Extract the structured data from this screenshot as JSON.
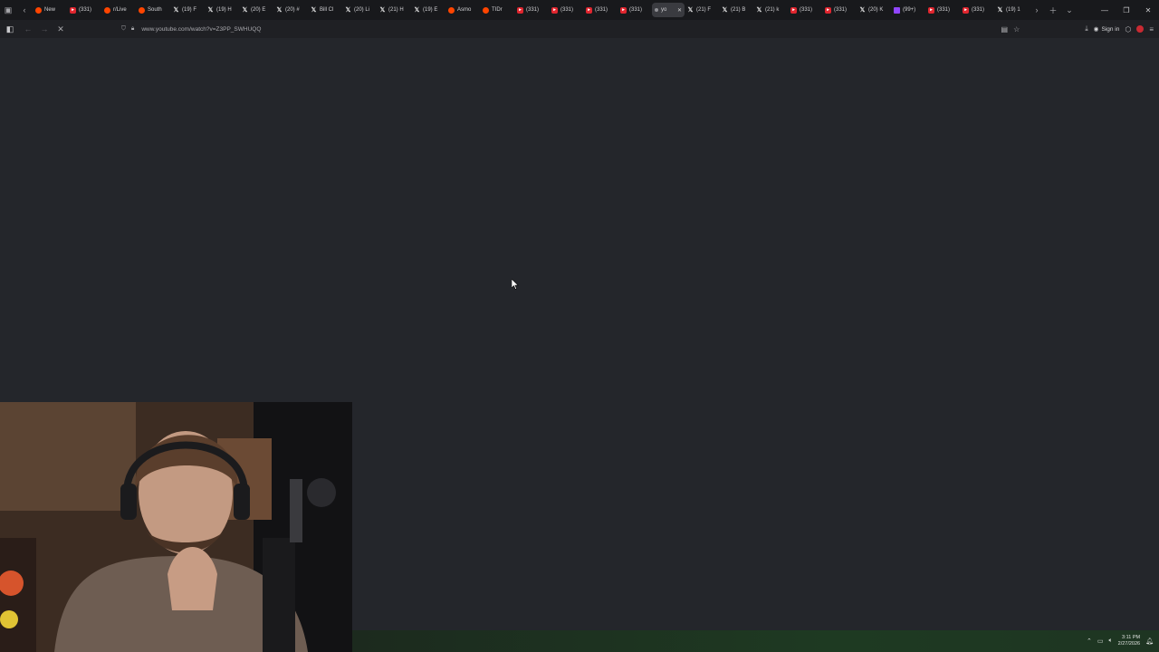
{
  "browser": {
    "tabs": [
      {
        "favicon": "reddit-icon",
        "title": "New"
      },
      {
        "favicon": "youtube-icon",
        "title": "(331)"
      },
      {
        "favicon": "reddit-icon",
        "title": "r/Live"
      },
      {
        "favicon": "reddit-icon",
        "title": "South"
      },
      {
        "favicon": "x-icon",
        "title": "(19) F"
      },
      {
        "favicon": "x-icon",
        "title": "(19) H"
      },
      {
        "favicon": "x-icon",
        "title": "(20) E"
      },
      {
        "favicon": "x-icon",
        "title": "(20) #"
      },
      {
        "favicon": "x-icon",
        "title": "Bill Cl"
      },
      {
        "favicon": "x-icon",
        "title": "(20) Li"
      },
      {
        "favicon": "x-icon",
        "title": "(21) H"
      },
      {
        "favicon": "x-icon",
        "title": "(19) E"
      },
      {
        "favicon": "reddit-icon",
        "title": "Asmo"
      },
      {
        "favicon": "reddit-icon",
        "title": "TIDr"
      },
      {
        "favicon": "youtube-icon",
        "title": "(331)"
      },
      {
        "favicon": "youtube-icon",
        "title": "(331)"
      },
      {
        "favicon": "youtube-icon",
        "title": "(331)"
      },
      {
        "favicon": "youtube-icon",
        "title": "(331)"
      },
      {
        "favicon": "loading-dot-icon",
        "title": "yo",
        "active": true
      },
      {
        "favicon": "x-icon",
        "title": "(21) F"
      },
      {
        "favicon": "x-icon",
        "title": "(21) B"
      },
      {
        "favicon": "x-icon",
        "title": "(21) k"
      },
      {
        "favicon": "youtube-icon",
        "title": "(331)"
      },
      {
        "favicon": "youtube-icon",
        "title": "(331)"
      },
      {
        "favicon": "x-icon",
        "title": "(20) K"
      },
      {
        "favicon": "twitch-icon",
        "title": "(99+)"
      },
      {
        "favicon": "youtube-icon",
        "title": "(331)"
      },
      {
        "favicon": "youtube-icon",
        "title": "(331)"
      },
      {
        "favicon": "x-icon",
        "title": "(19) 1"
      }
    ],
    "url": "www.youtube.com/watch?v=Z3PP_SWHUQQ",
    "sign_in_label": "Sign in",
    "colors": {
      "youtube": "#e0262f",
      "reddit": "#ff4500",
      "twitch": "#9146ff",
      "page_bg": "#24262b"
    }
  },
  "taskbar": {
    "time": "3:11 PM",
    "date": "2/27/2026"
  }
}
